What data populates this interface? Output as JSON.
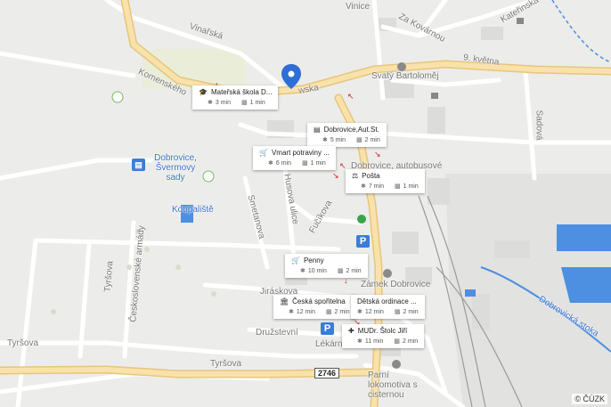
{
  "streets": {
    "vinarska": "Vinařská",
    "komenskeho": "Komenského",
    "vinice": "Vinice",
    "za_kovarnou": "Za Kovárnou",
    "katerinska": "Kateřinská",
    "devet_kvetna": "9. května",
    "sadova": "Sadová",
    "husova": "Husova ulice",
    "smetanova": "Smetanova",
    "fucikova": "Fučíkova",
    "ceskoslovenske_armady": "Československé armády",
    "tyrsova_left": "Tyršova",
    "tyrsova_bottom": "Tyršova",
    "tyrsova_vertical": "Tyršova",
    "druzstevni": "Družstevní",
    "jiraskova": "Jiráskova",
    "lekarna": "Lékárna",
    "dobrovicka_stoka": "Dobrovická stoka",
    "wska": "wska"
  },
  "places": {
    "svaty_bartolomej": "Svatý Bartoloměj",
    "dobrovice_svermovy_sady": "Dobrovice, Švermovy sady",
    "koupaliste": "Koupaliště",
    "dobrovice_autobusove": "Dobrovice, autobusové",
    "zamek_dobrovice": "Zámek Dobrovice",
    "parni_lokomotiva": "Parní lokomotiva s cisternou"
  },
  "road_number": "2746",
  "parking_label": "P",
  "cards": [
    {
      "name": "Mateřská škola D...",
      "icon": "school-icon",
      "walk": "3 min",
      "car": "1 min"
    },
    {
      "name": "Dobrovice,Aut.St.",
      "icon": "bus-icon",
      "walk": "5 min",
      "car": "2 min"
    },
    {
      "name": "Vmart potraviny ...",
      "icon": "cart-icon",
      "walk": "6 min",
      "car": "1 min"
    },
    {
      "name": "Pošta",
      "icon": "post-icon",
      "walk": "7 min",
      "car": "1 min"
    },
    {
      "name": "Penny",
      "icon": "cart-icon",
      "walk": "10 min",
      "car": "2 min"
    },
    {
      "name": "Česká spořitelna",
      "icon": "bank-icon",
      "walk": "12 min",
      "car": "2 min"
    },
    {
      "name": "Dětská ordinace ...",
      "icon": "medical-icon",
      "walk": "12 min",
      "car": "2 min"
    },
    {
      "name": "MUDr. Štolc Jiří",
      "icon": "medical-icon",
      "walk": "11 min",
      "car": "2 min"
    }
  ],
  "copyright": "© ČÚZK",
  "colors": {
    "background": "#ececea",
    "main_road": "#f3d79a",
    "water": "#4d8fe0",
    "marker": "#2d6fd6",
    "rail": "#9a9a9a"
  }
}
